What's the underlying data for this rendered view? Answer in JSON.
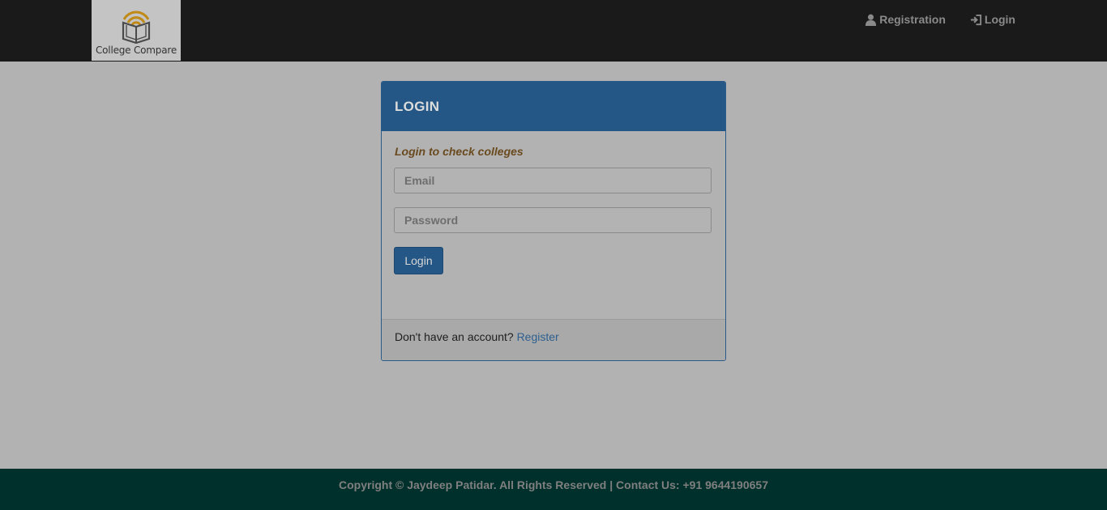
{
  "brand": {
    "name": "College Compare",
    "icon": "book-wifi-logo"
  },
  "nav": {
    "registration_label": "Registration",
    "registration_icon": "user-icon",
    "login_label": "Login",
    "login_icon": "sign-in-icon"
  },
  "login_panel": {
    "title": "LOGIN",
    "subtitle": "Login to check colleges",
    "email_placeholder": "Email",
    "password_placeholder": "Password",
    "submit_label": "Login",
    "footer_text": "Don't have an account? ",
    "register_link": "Register"
  },
  "footer": {
    "text": "Copyright © Jaydeep Patidar. All Rights Reserved | Contact Us: +91 9644190657"
  },
  "colors": {
    "navbar": "#1a1a1a",
    "panel_header": "#245785",
    "footer": "#00302b",
    "overlay_background": "#b2b2b2"
  }
}
